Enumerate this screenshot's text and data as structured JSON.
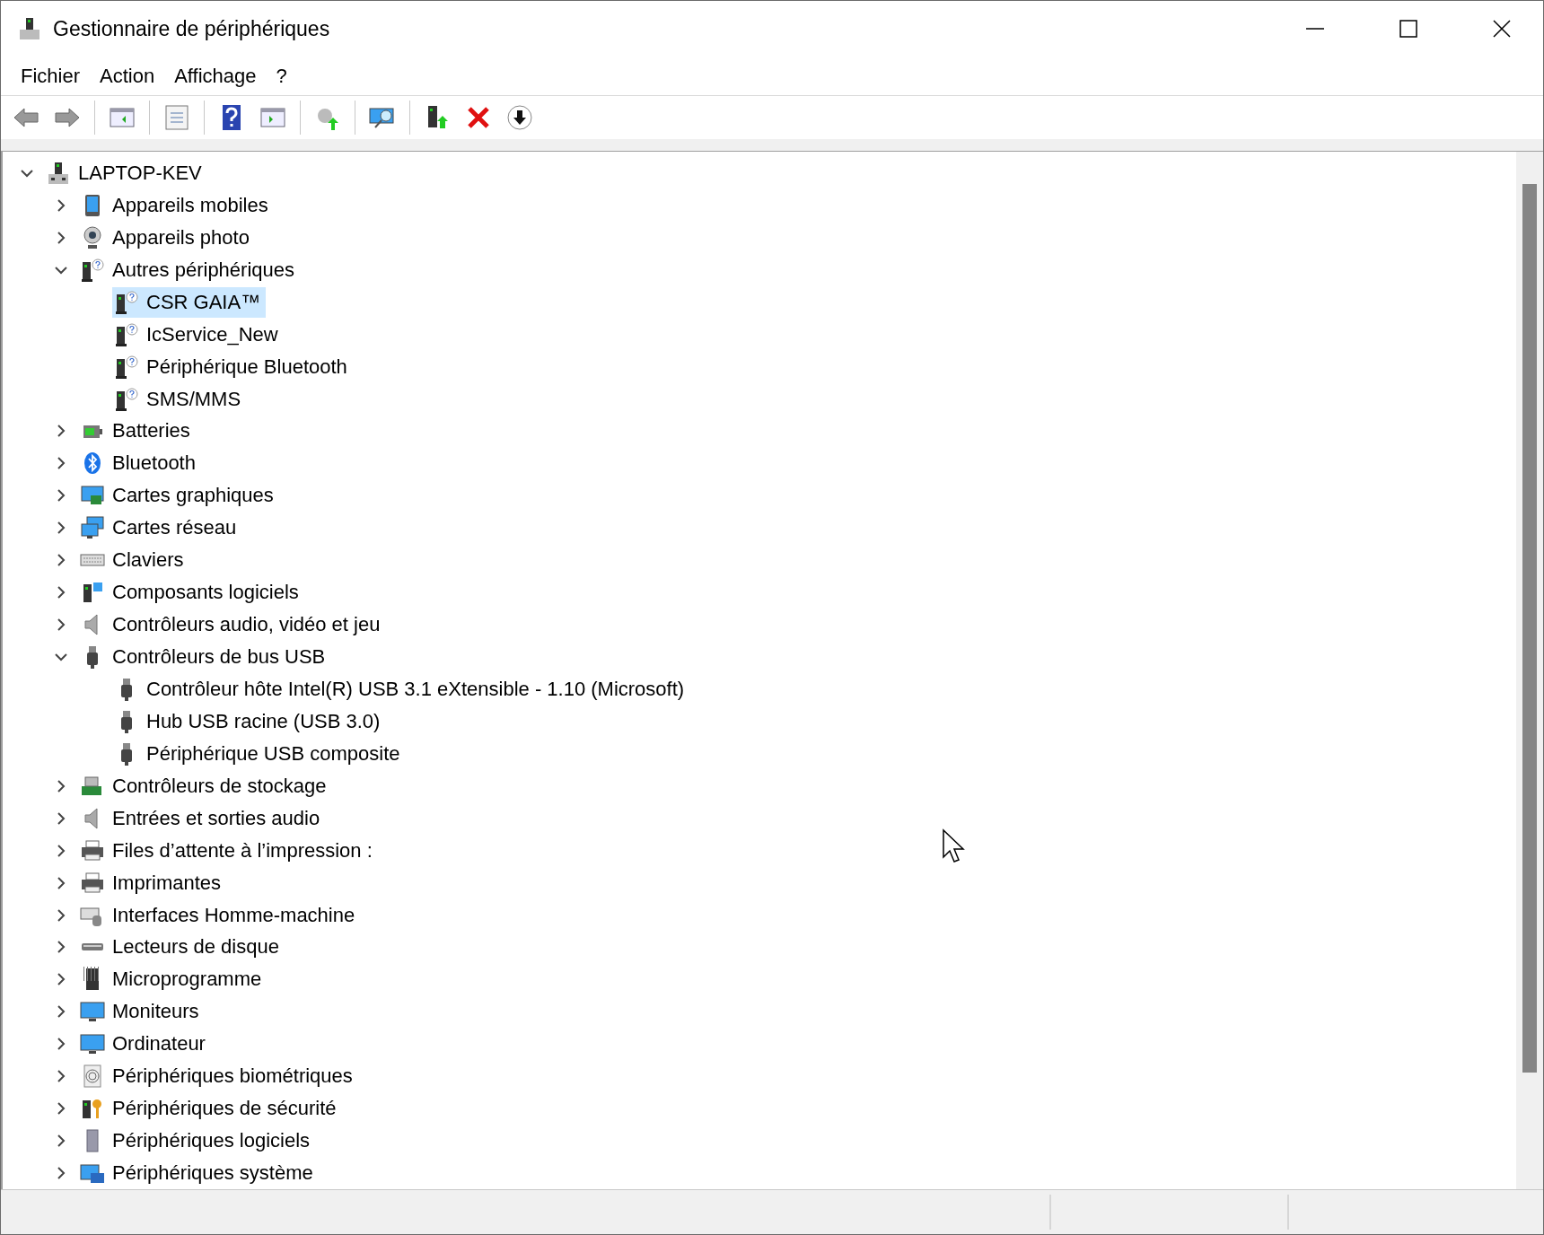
{
  "window": {
    "title": "Gestionnaire de périphériques"
  },
  "menu": [
    {
      "label": "Fichier"
    },
    {
      "label": "Action"
    },
    {
      "label": "Affichage"
    },
    {
      "label": "?"
    }
  ],
  "tree": {
    "label": "LAPTOP-KEV",
    "expanded": true,
    "selected": false,
    "children": [
      {
        "label": "Appareils mobiles",
        "expanded": false,
        "selected": false
      },
      {
        "label": "Appareils photo",
        "expanded": false,
        "selected": false
      },
      {
        "label": "Autres périphériques",
        "expanded": true,
        "selected": false,
        "children": [
          {
            "label": "CSR GAIA™",
            "selected": true
          },
          {
            "label": "IcService_New",
            "selected": false
          },
          {
            "label": "Périphérique Bluetooth",
            "selected": false
          },
          {
            "label": "SMS/MMS",
            "selected": false
          }
        ]
      },
      {
        "label": "Batteries",
        "expanded": false,
        "selected": false
      },
      {
        "label": "Bluetooth",
        "expanded": false,
        "selected": false
      },
      {
        "label": "Cartes graphiques",
        "expanded": false,
        "selected": false
      },
      {
        "label": "Cartes réseau",
        "expanded": false,
        "selected": false
      },
      {
        "label": "Claviers",
        "expanded": false,
        "selected": false
      },
      {
        "label": "Composants logiciels",
        "expanded": false,
        "selected": false
      },
      {
        "label": "Contrôleurs audio, vidéo et jeu",
        "expanded": false,
        "selected": false
      },
      {
        "label": "Contrôleurs de bus USB",
        "expanded": true,
        "selected": false,
        "children": [
          {
            "label": "Contrôleur hôte Intel(R) USB 3.1 eXtensible - 1.10 (Microsoft)",
            "selected": false
          },
          {
            "label": "Hub USB racine (USB 3.0)",
            "selected": false
          },
          {
            "label": "Périphérique USB composite",
            "selected": false
          }
        ]
      },
      {
        "label": "Contrôleurs de stockage",
        "expanded": false,
        "selected": false
      },
      {
        "label": "Entrées et sorties audio",
        "expanded": false,
        "selected": false
      },
      {
        "label": "Files d’attente à l’impression :",
        "expanded": false,
        "selected": false
      },
      {
        "label": "Imprimantes",
        "expanded": false,
        "selected": false
      },
      {
        "label": "Interfaces Homme-machine",
        "expanded": false,
        "selected": false
      },
      {
        "label": "Lecteurs de disque",
        "expanded": false,
        "selected": false
      },
      {
        "label": "Microprogramme",
        "expanded": false,
        "selected": false
      },
      {
        "label": "Moniteurs",
        "expanded": false,
        "selected": false
      },
      {
        "label": "Ordinateur",
        "expanded": false,
        "selected": false
      },
      {
        "label": "Périphériques biométriques",
        "expanded": false,
        "selected": false
      },
      {
        "label": "Périphériques de sécurité",
        "expanded": false,
        "selected": false
      },
      {
        "label": "Périphériques logiciels",
        "expanded": false,
        "selected": false
      },
      {
        "label": "Périphériques système",
        "expanded": false,
        "selected": false
      }
    ]
  }
}
